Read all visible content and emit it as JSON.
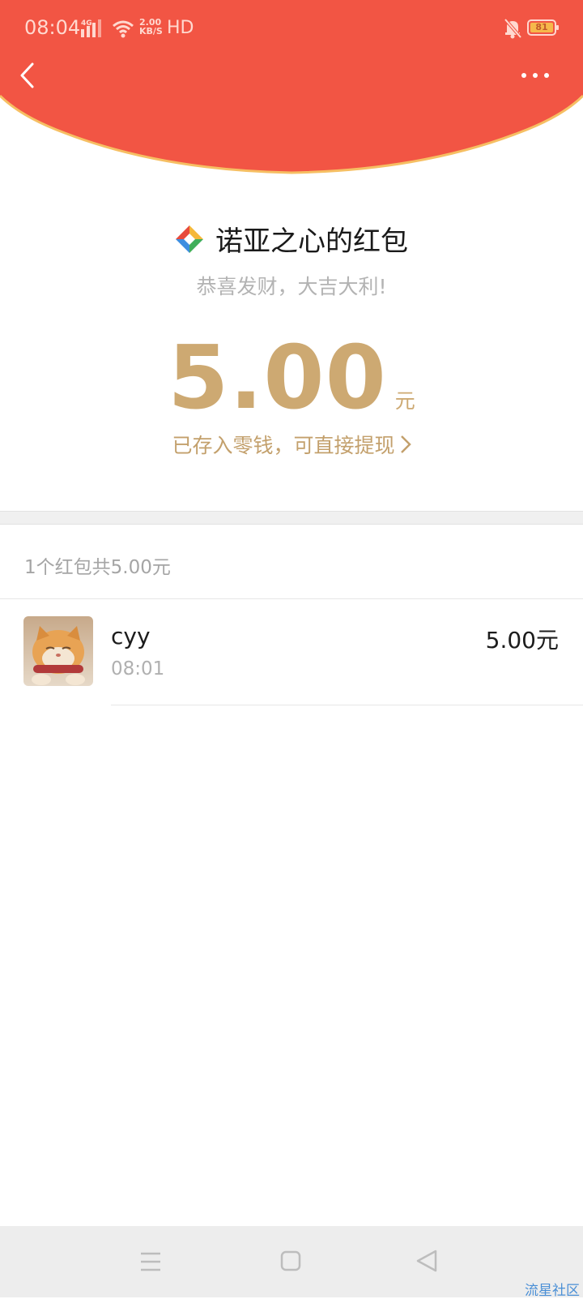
{
  "status_bar": {
    "time": "08:04",
    "network": "4G",
    "speed_value": "2.00",
    "speed_unit": "KB/S",
    "hd": "HD",
    "battery": "81"
  },
  "header": {
    "accent_color": "#f25544",
    "rim_color": "#f6bf63"
  },
  "envelope": {
    "sender": "诺亚之心的红包",
    "greeting": "恭喜发财，大吉大利!",
    "amount": "5.00",
    "amount_unit": "元",
    "wallet_link": "已存入零钱，可直接提现"
  },
  "summary": "1个红包共5.00元",
  "receivers": [
    {
      "name": "cyy",
      "time": "08:01",
      "amount": "5.00元"
    }
  ],
  "watermark": "流星社区"
}
